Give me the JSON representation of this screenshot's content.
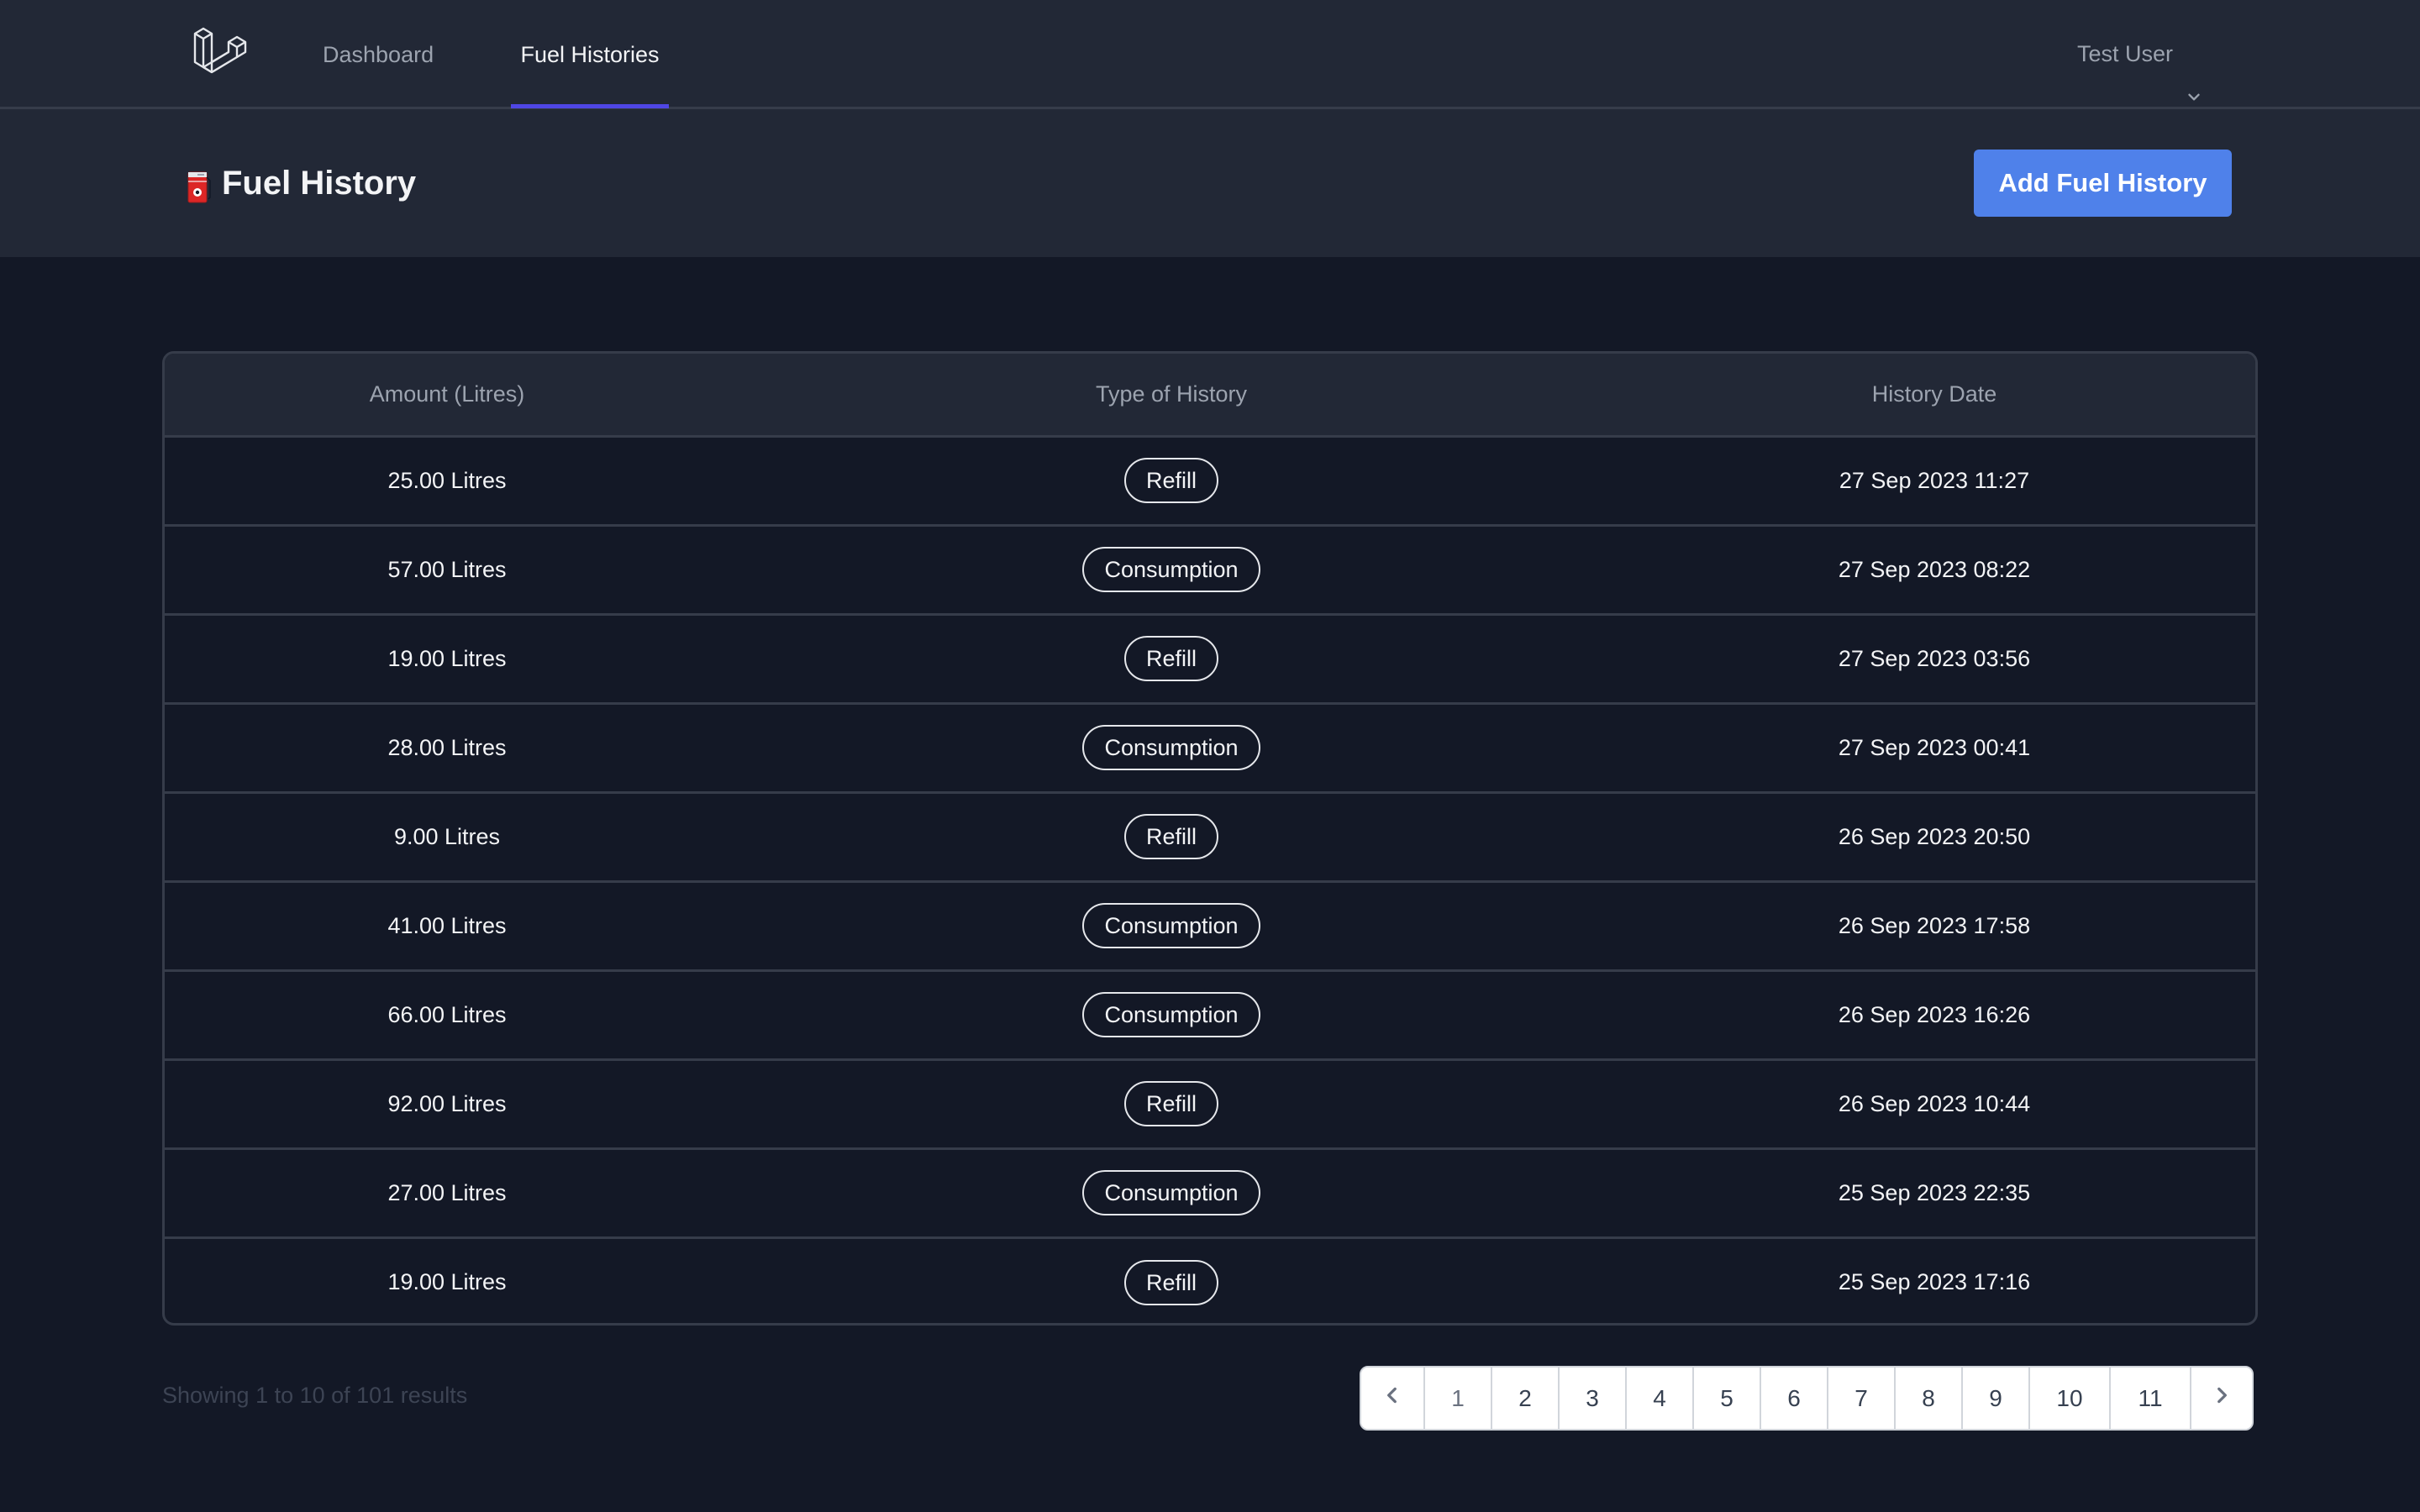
{
  "nav": {
    "logo": "laravel-logo",
    "links": [
      {
        "label": "Dashboard",
        "active": false
      },
      {
        "label": "Fuel Histories",
        "active": true
      }
    ],
    "user": {
      "name": "Test User",
      "icon": "chevron-down-icon"
    }
  },
  "header": {
    "icon": "fuel-pump-emoji",
    "title": "Fuel History",
    "add_button_label": "Add Fuel History",
    "accent_color": "#4f81ea"
  },
  "table": {
    "columns": [
      "Amount (Litres)",
      "Type of History",
      "History Date"
    ],
    "rows": [
      {
        "amount": "25.00 Litres",
        "type": "Refill",
        "date": "27 Sep 2023 11:27"
      },
      {
        "amount": "57.00 Litres",
        "type": "Consumption",
        "date": "27 Sep 2023 08:22"
      },
      {
        "amount": "19.00 Litres",
        "type": "Refill",
        "date": "27 Sep 2023 03:56"
      },
      {
        "amount": "28.00 Litres",
        "type": "Consumption",
        "date": "27 Sep 2023 00:41"
      },
      {
        "amount": "9.00 Litres",
        "type": "Refill",
        "date": "26 Sep 2023 20:50"
      },
      {
        "amount": "41.00 Litres",
        "type": "Consumption",
        "date": "26 Sep 2023 17:58"
      },
      {
        "amount": "66.00 Litres",
        "type": "Consumption",
        "date": "26 Sep 2023 16:26"
      },
      {
        "amount": "92.00 Litres",
        "type": "Refill",
        "date": "26 Sep 2023 10:44"
      },
      {
        "amount": "27.00 Litres",
        "type": "Consumption",
        "date": "25 Sep 2023 22:35"
      },
      {
        "amount": "19.00 Litres",
        "type": "Refill",
        "date": "25 Sep 2023 17:16"
      }
    ]
  },
  "footer": {
    "showing_text": "Showing 1 to 10 of 101 results",
    "pagination": {
      "prev_icon": "chevron-left-icon",
      "next_icon": "chevron-right-icon",
      "current_page": "1",
      "pages": [
        "1",
        "2",
        "3",
        "4",
        "5",
        "6",
        "7",
        "8",
        "9",
        "10",
        "11"
      ]
    }
  }
}
